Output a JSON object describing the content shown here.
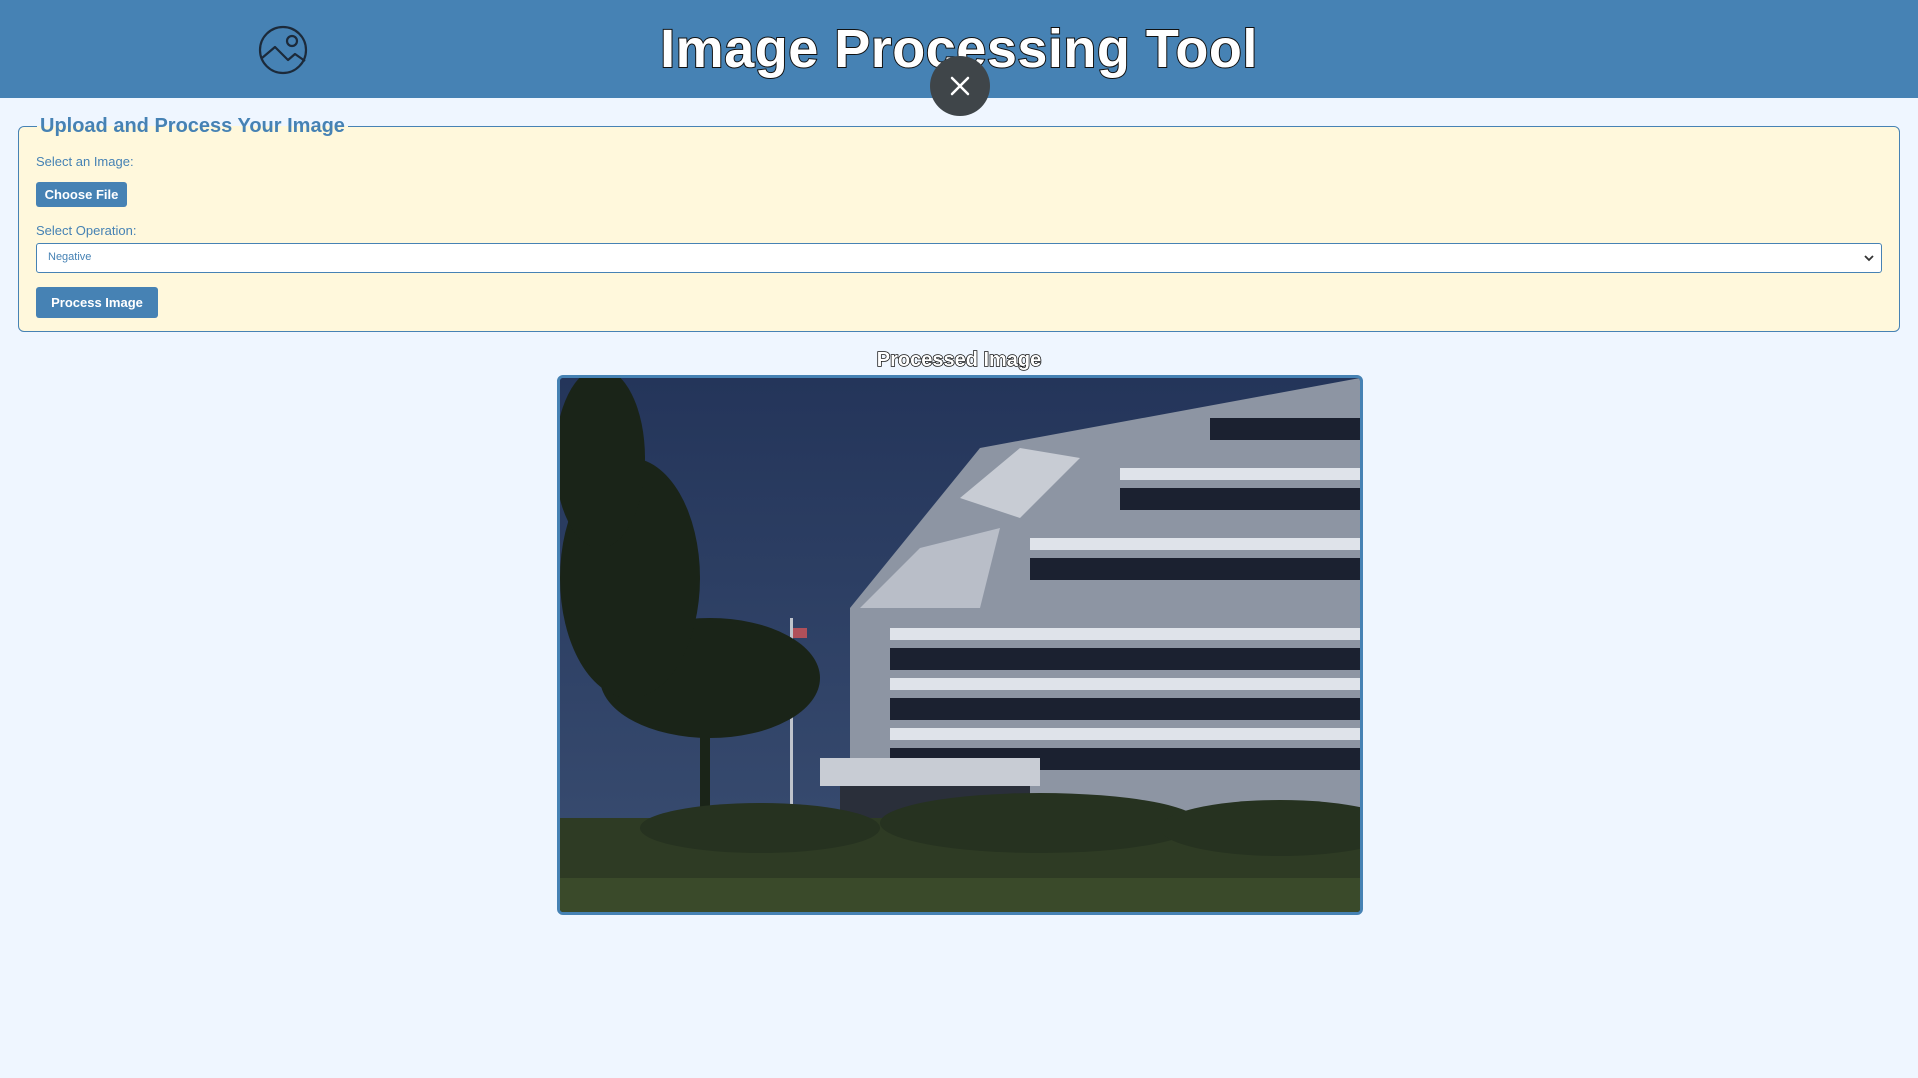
{
  "header": {
    "title": "Image Processing Tool"
  },
  "panel": {
    "legend": "Upload and Process Your Image",
    "select_image_label": "Select an Image:",
    "choose_file_label": "Choose File",
    "select_operation_label": "Select Operation:",
    "operation_selected": "Negative",
    "process_button_label": "Process Image"
  },
  "result": {
    "title": "Processed Image"
  },
  "colors": {
    "header_bg": "#4682b4",
    "accent": "#4682b4",
    "panel_bg": "#fff8dc",
    "page_bg": "#eff6ff"
  },
  "icons": [
    "image-logo-icon",
    "close-icon",
    "chevron-down-icon"
  ]
}
